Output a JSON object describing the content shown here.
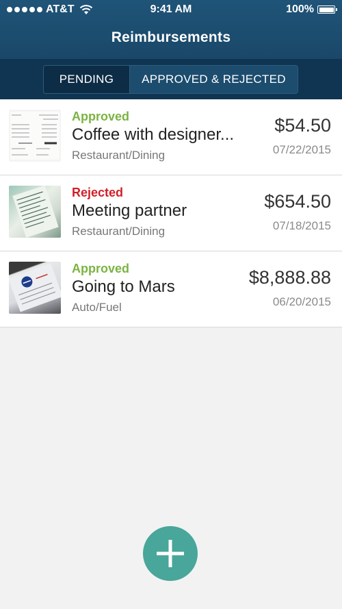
{
  "status_bar": {
    "carrier": "AT&T",
    "time": "9:41 AM",
    "battery": "100%"
  },
  "header": {
    "title": "Reimbursements"
  },
  "tabs": [
    {
      "label": "PENDING",
      "selected": false
    },
    {
      "label": "APPROVED & REJECTED",
      "selected": true
    }
  ],
  "items": [
    {
      "status": "Approved",
      "name": "Coffee with designer...",
      "category": "Restaurant/Dining",
      "amount": "$54.50",
      "date": "07/22/2015"
    },
    {
      "status": "Rejected",
      "name": "Meeting partner",
      "category": "Restaurant/Dining",
      "amount": "$654.50",
      "date": "07/18/2015"
    },
    {
      "status": "Approved",
      "name": "Going to Mars",
      "category": "Auto/Fuel",
      "amount": "$8,888.88",
      "date": "06/20/2015"
    }
  ],
  "colors": {
    "header": "#1f5478",
    "approved": "#7bb342",
    "rejected": "#d0202a",
    "fab": "#48a69a"
  },
  "icons": {
    "fab": "plus-icon",
    "wifi": "wifi-icon",
    "battery": "battery-icon"
  }
}
